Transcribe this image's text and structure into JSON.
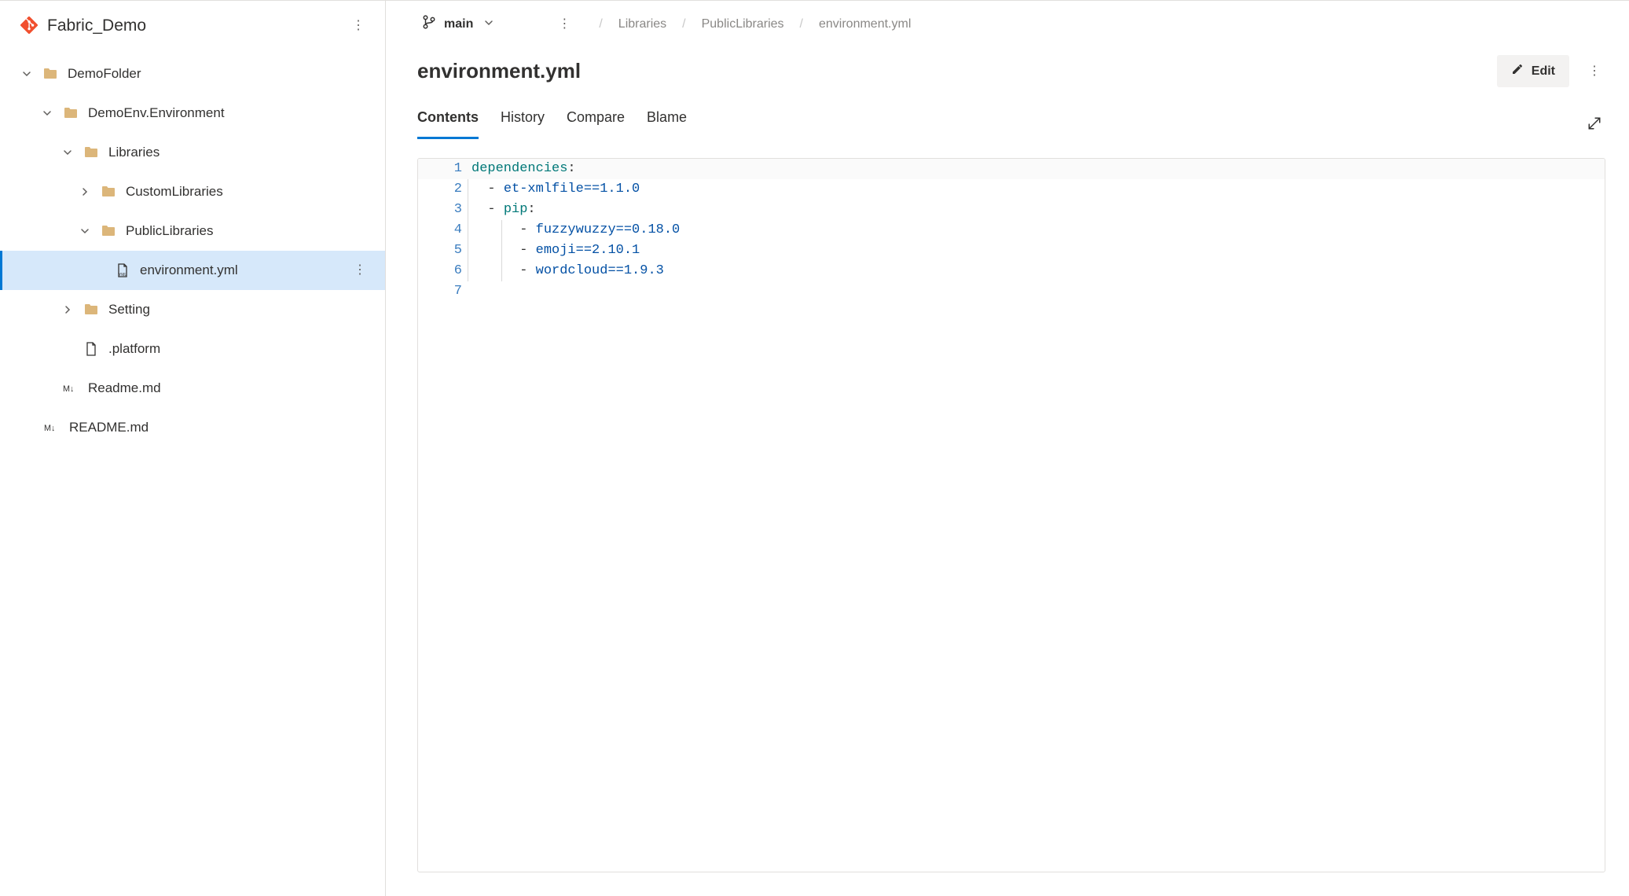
{
  "sidebar": {
    "repo_name": "Fabric_Demo",
    "tree": {
      "demofolder": "DemoFolder",
      "demoenv": "DemoEnv.Environment",
      "libraries": "Libraries",
      "customlibraries": "CustomLibraries",
      "publiclibraries": "PublicLibraries",
      "environment_yml": "environment.yml",
      "setting": "Setting",
      "platform": ".platform",
      "readme_inner": "Readme.md",
      "readme_root": "README.md"
    }
  },
  "topbar": {
    "branch": "main",
    "breadcrumb": {
      "libraries": "Libraries",
      "publiclibraries": "PublicLibraries",
      "file": "environment.yml"
    }
  },
  "file_header": {
    "title": "environment.yml",
    "edit_label": "Edit"
  },
  "tabs": {
    "contents": "Contents",
    "history": "History",
    "compare": "Compare",
    "blame": "Blame"
  },
  "code": {
    "lines": [
      {
        "n": 1,
        "parts": [
          {
            "k": "key",
            "t": "dependencies"
          },
          {
            "k": "plain",
            "t": ":"
          }
        ],
        "indent": 0
      },
      {
        "n": 2,
        "parts": [
          {
            "k": "plain",
            "t": "  - "
          },
          {
            "k": "str",
            "t": "et-xmlfile==1.1.0"
          }
        ],
        "indent": 1
      },
      {
        "n": 3,
        "parts": [
          {
            "k": "plain",
            "t": "  - "
          },
          {
            "k": "key",
            "t": "pip"
          },
          {
            "k": "plain",
            "t": ":"
          }
        ],
        "indent": 1
      },
      {
        "n": 4,
        "parts": [
          {
            "k": "plain",
            "t": "      - "
          },
          {
            "k": "str",
            "t": "fuzzywuzzy==0.18.0"
          }
        ],
        "indent": 2
      },
      {
        "n": 5,
        "parts": [
          {
            "k": "plain",
            "t": "      - "
          },
          {
            "k": "str",
            "t": "emoji==2.10.1"
          }
        ],
        "indent": 2
      },
      {
        "n": 6,
        "parts": [
          {
            "k": "plain",
            "t": "      - "
          },
          {
            "k": "str",
            "t": "wordcloud==1.9.3"
          }
        ],
        "indent": 2
      },
      {
        "n": 7,
        "parts": [],
        "indent": 0
      }
    ]
  }
}
